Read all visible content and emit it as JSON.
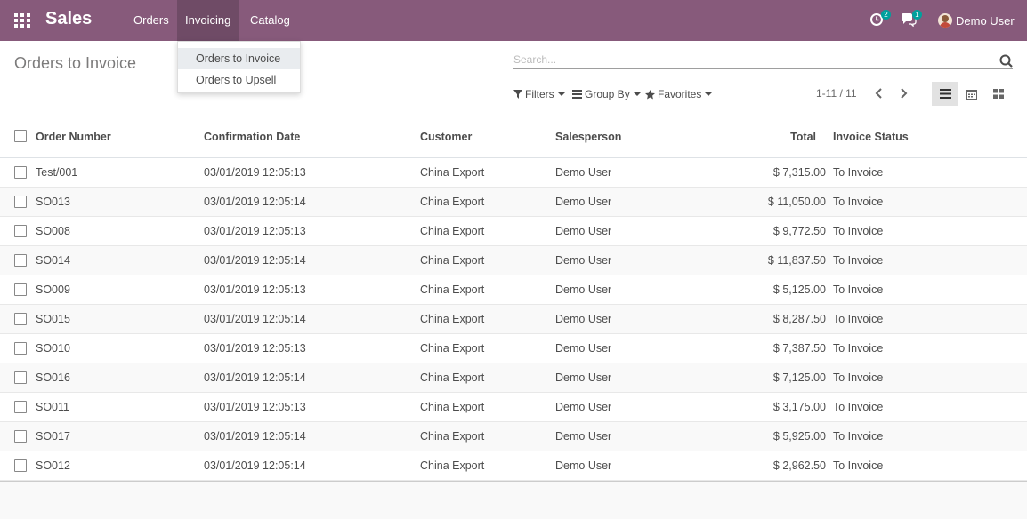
{
  "navbar": {
    "app_title": "Sales",
    "menu": [
      "Orders",
      "Invoicing",
      "Catalog"
    ],
    "activity_count": "2",
    "message_count": "1",
    "user_name": "Demo User",
    "color": "#875a7b"
  },
  "dropdown": {
    "items": [
      "Orders to Invoice",
      "Orders to Upsell"
    ]
  },
  "control_panel": {
    "breadcrumb": "Orders to Invoice",
    "search_placeholder": "Search...",
    "filters_label": "Filters",
    "group_by_label": "Group By",
    "favorites_label": "Favorites",
    "pager": "1-11 / 11",
    "views": [
      "list-view-icon",
      "calendar-view-icon",
      "kanban-view-icon"
    ]
  },
  "table": {
    "columns": [
      "Order Number",
      "Confirmation Date",
      "Customer",
      "Salesperson",
      "Total",
      "Invoice Status"
    ],
    "rows": [
      [
        "Test/001",
        "03/01/2019 12:05:13",
        "China Export",
        "Demo User",
        "$ 7,315.00",
        "To Invoice"
      ],
      [
        "SO013",
        "03/01/2019 12:05:14",
        "China Export",
        "Demo User",
        "$ 11,050.00",
        "To Invoice"
      ],
      [
        "SO008",
        "03/01/2019 12:05:13",
        "China Export",
        "Demo User",
        "$ 9,772.50",
        "To Invoice"
      ],
      [
        "SO014",
        "03/01/2019 12:05:14",
        "China Export",
        "Demo User",
        "$ 11,837.50",
        "To Invoice"
      ],
      [
        "SO009",
        "03/01/2019 12:05:13",
        "China Export",
        "Demo User",
        "$ 5,125.00",
        "To Invoice"
      ],
      [
        "SO015",
        "03/01/2019 12:05:14",
        "China Export",
        "Demo User",
        "$ 8,287.50",
        "To Invoice"
      ],
      [
        "SO010",
        "03/01/2019 12:05:13",
        "China Export",
        "Demo User",
        "$ 7,387.50",
        "To Invoice"
      ],
      [
        "SO016",
        "03/01/2019 12:05:14",
        "China Export",
        "Demo User",
        "$ 7,125.00",
        "To Invoice"
      ],
      [
        "SO011",
        "03/01/2019 12:05:13",
        "China Export",
        "Demo User",
        "$ 3,175.00",
        "To Invoice"
      ],
      [
        "SO017",
        "03/01/2019 12:05:14",
        "China Export",
        "Demo User",
        "$ 5,925.00",
        "To Invoice"
      ],
      [
        "SO012",
        "03/01/2019 12:05:14",
        "China Export",
        "Demo User",
        "$ 2,962.50",
        "To Invoice"
      ]
    ]
  }
}
